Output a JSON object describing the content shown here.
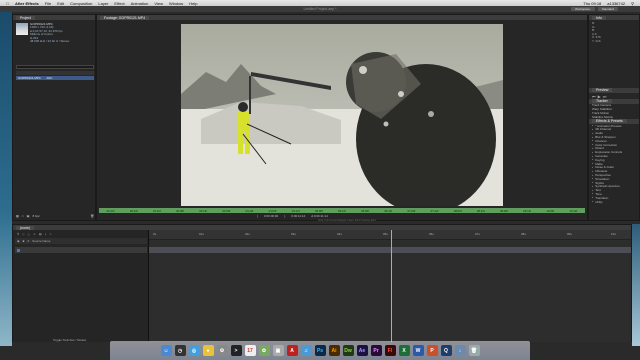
{
  "menubar": {
    "apple": "",
    "app": "After Effects",
    "items": [
      "File",
      "Edit",
      "Composition",
      "Layer",
      "Effect",
      "Animation",
      "View",
      "Window",
      "Help"
    ],
    "clock": "Thu 09:18",
    "user": "a1336742"
  },
  "window": {
    "title": "Untitled Project.aep *",
    "workspaces": [
      "Workspace:",
      "Standard"
    ]
  },
  "project": {
    "tab": "Project",
    "file": "GOPR0121.MP4",
    "lines": [
      "1280 x 720 (1.00)",
      "Δ 0;01;57;10, 23.976 fps",
      "Millions of Colors",
      "H.264",
      "48.000 kHz / 32 bit U / Stereo"
    ],
    "row_name": "GOPR0121.MP4",
    "row_type": "AVC",
    "footer": "8 bpc"
  },
  "viewer": {
    "tab": "Footage: GOPR0121.MP4",
    "ruler": [
      "00:12f",
      "00:24f",
      "01:12f",
      "02:00f",
      "02:12f",
      "03:00f",
      "03:12f",
      "04:00f",
      "04:12f",
      "05:00f",
      "05:12f",
      "06:00f",
      "06:12f",
      "07:00f",
      "07:12f",
      "08:00f",
      "08:12f",
      "09:00f",
      "09:12f",
      "10:00f",
      "10:12f"
    ],
    "controls": [
      "0:00:00:00",
      "0:00:11:14",
      "Δ 0:00:11:14"
    ],
    "note": "Edit Untrimmed  Ripple Insert Edit  Overlay Edit"
  },
  "right": {
    "preview": "Preview",
    "info": [
      "R:",
      "G:",
      "B:",
      "A:0",
      "X: 376",
      "Y: 416"
    ],
    "tracker": "Tracker",
    "track_items": [
      "Track Camera",
      "Warp Stabilizer",
      "Track Motion",
      "Stabilize Motion"
    ],
    "effects_tab": "Effects & Presets",
    "effects": [
      "* Animation Presets",
      "3D Channel",
      "Audio",
      "Blur & Sharpen",
      "Channel",
      "Color Correction",
      "Distort",
      "Expression Controls",
      "Generate",
      "Keying",
      "Matte",
      "Noise & Grain",
      "Obsolete",
      "Perspective",
      "Simulation",
      "Stylize",
      "Synthetic Aperture",
      "Text",
      "Time",
      "Transition",
      "Utility"
    ]
  },
  "timeline": {
    "tab": "(none)",
    "layer_name": "Source Name",
    "ruler": [
      "0s",
      "01s",
      "02s",
      "03s",
      "04s",
      "05s",
      "06s",
      "07s",
      "08s",
      "09s",
      "10s"
    ],
    "footer": "Toggle Switches / Modes"
  },
  "dock": [
    "Finder",
    "Dashboard",
    "Safari",
    "Chrome",
    "System Preferences",
    "Terminal",
    "Calendar",
    "Photos",
    "Preview",
    "Acrobat",
    "iTunes",
    "Photoshop",
    "Illustrator",
    "Dreamweaver",
    "After Effects",
    "Premiere",
    "Flash",
    "Excel",
    "Word",
    "PowerPoint",
    "Quicktime",
    "Downloads",
    "Trash"
  ]
}
